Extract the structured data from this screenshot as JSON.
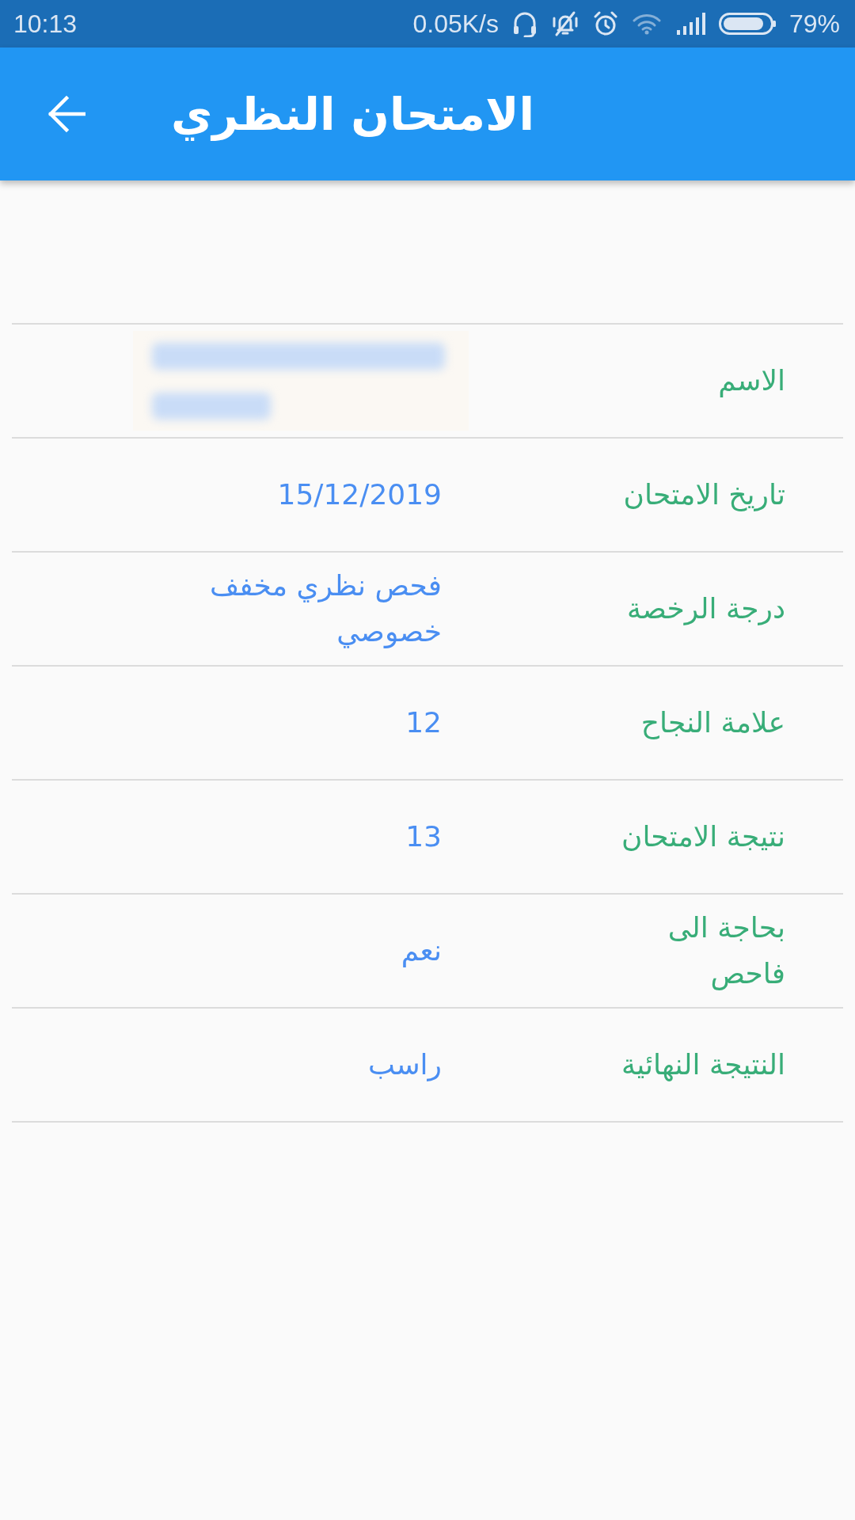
{
  "status_bar": {
    "time": "10:13",
    "network_speed": "0.05K/s",
    "battery_percent": "79%"
  },
  "app_bar": {
    "title": "الامتحان النظري"
  },
  "rows": [
    {
      "kind": "redacted",
      "label": "الاسم"
    },
    {
      "kind": "text",
      "label": "تاريخ الامتحان",
      "value": "15/12/2019"
    },
    {
      "kind": "text",
      "label": "درجة الرخصة",
      "value": "فحص نظري مخفف خصوصي"
    },
    {
      "kind": "text",
      "label": "علامة النجاح",
      "value": "12"
    },
    {
      "kind": "text",
      "label": "نتيجة الامتحان",
      "value": "13"
    },
    {
      "kind": "text",
      "label": "بحاجة الى فاحص",
      "value": "نعم"
    },
    {
      "kind": "text",
      "label": "النتيجة النهائية",
      "value": "راسب"
    }
  ]
}
